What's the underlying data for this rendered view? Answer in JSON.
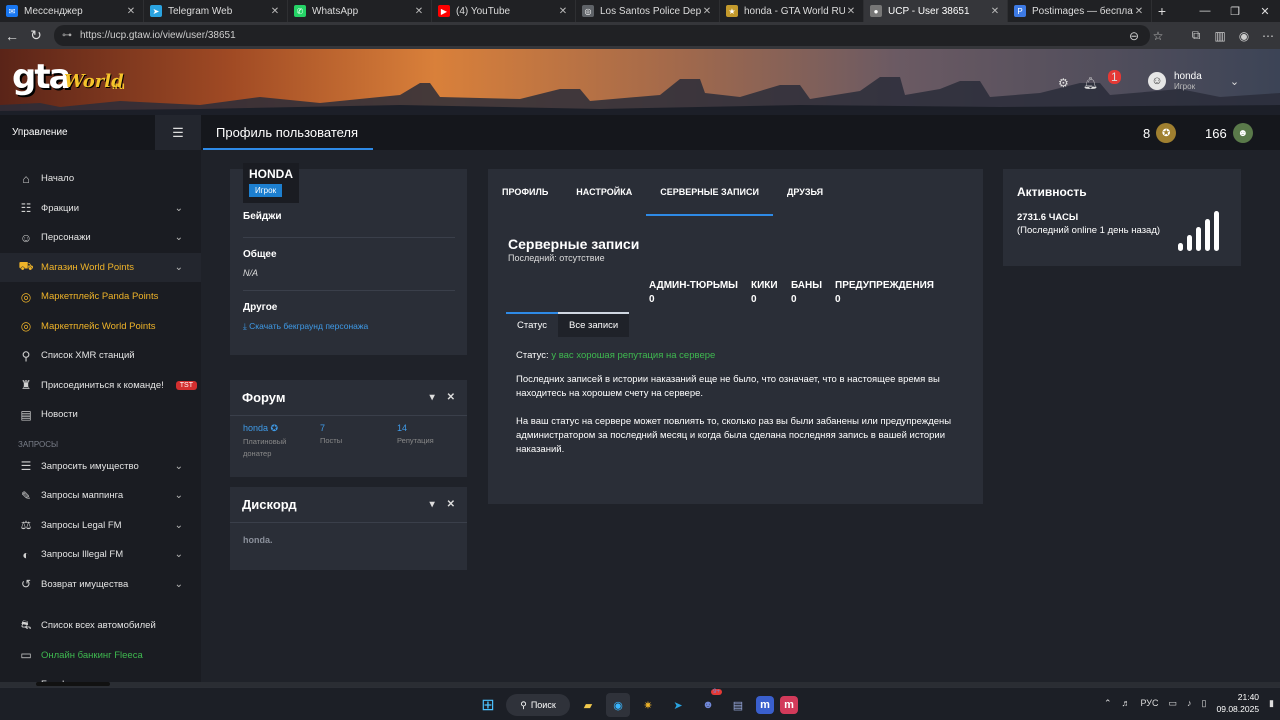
{
  "browser": {
    "tabs": [
      {
        "title": "Мессенджер",
        "color": "#1877f2",
        "glyph": "✉"
      },
      {
        "title": "Telegram Web",
        "color": "#2aa3e0",
        "glyph": "➤"
      },
      {
        "title": "WhatsApp",
        "color": "#25d366",
        "glyph": "✆"
      },
      {
        "title": "(4) YouTube",
        "color": "#ff0000",
        "glyph": "▶"
      },
      {
        "title": "Los Santos Police Departme",
        "color": "#5f6368",
        "glyph": "◎"
      },
      {
        "title": "honda - GTA World RU",
        "color": "#c49a2c",
        "glyph": "★"
      },
      {
        "title": "UCP - User 38651",
        "color": "#777777",
        "glyph": "●"
      },
      {
        "title": "Postimages — бесплатный",
        "color": "#3d7ae4",
        "glyph": "P"
      }
    ],
    "active_tab": 6,
    "url": "https://ucp.gtaw.io/view/user/38651"
  },
  "header": {
    "logo_main": "gta",
    "logo_world": "World",
    "logo_ru": ".ru",
    "notif_count": "1",
    "username": "honda",
    "role": "Игрок"
  },
  "sidebar": {
    "title": "Управление",
    "items": [
      {
        "label": "Начало",
        "icon": "home-icon",
        "glyph": "⌂"
      },
      {
        "label": "Фракции",
        "icon": "users-icon",
        "glyph": "☷",
        "chevron": true
      },
      {
        "label": "Персонажи",
        "icon": "user-icon",
        "glyph": "☺",
        "chevron": true
      },
      {
        "label": "Магазин World Points",
        "icon": "cart-icon",
        "glyph": "⛟",
        "chevron": true,
        "active": true
      },
      {
        "label": "Маркетплейс Panda Points",
        "icon": "coins-icon",
        "glyph": "◎",
        "gold": true
      },
      {
        "label": "Маркетплейс World Points",
        "icon": "coins-icon",
        "glyph": "◎",
        "gold": true
      },
      {
        "label": "Список XMR станций",
        "icon": "antenna-icon",
        "glyph": "⚲"
      },
      {
        "label": "Присоединиться к команде!",
        "icon": "user-tie-icon",
        "glyph": "♜",
        "tag": "TST"
      },
      {
        "label": "Новости",
        "icon": "news-icon",
        "glyph": "▤"
      }
    ],
    "section_requests": "ЗАПРОСЫ",
    "requests": [
      {
        "label": "Запросить имущество",
        "icon": "list-icon",
        "glyph": "☰"
      },
      {
        "label": "Запросы маппинга",
        "icon": "brush-icon",
        "glyph": "✎"
      },
      {
        "label": "Запросы Legal FM",
        "icon": "scale-icon",
        "glyph": "⚖"
      },
      {
        "label": "Запросы Illegal FM",
        "icon": "mask-icon",
        "glyph": "◐"
      },
      {
        "label": "Возврат имущества",
        "icon": "undo-icon",
        "glyph": "↺"
      }
    ],
    "extra": [
      {
        "label": "Список всех автомобилей",
        "icon": "car-icon",
        "glyph": "⛐"
      },
      {
        "label": "Онлайн банкинг Fleeca",
        "icon": "bank-icon",
        "glyph": "▭",
        "green": true
      },
      {
        "label": "Facebrowser",
        "icon": "user-icon",
        "glyph": "☺"
      }
    ]
  },
  "topbar": {
    "page_title": "Профиль пользователя",
    "stat1": "8",
    "stat2": "166"
  },
  "profile": {
    "name": "HONDA",
    "badge": "Игрок",
    "badges_label": "Бейджи",
    "general_label": "Общее",
    "general_value": "N/A",
    "other_label": "Другое",
    "download_link": "Скачать бекграунд персонажа"
  },
  "forum": {
    "title": "Форум",
    "user": "honda",
    "user_role": "Платиновый донатер",
    "posts": "7",
    "posts_label": "Посты",
    "rep": "14",
    "rep_label": "Репутация"
  },
  "discord": {
    "title": "Дискорд",
    "name": "honda."
  },
  "records": {
    "tabs": [
      "ПРОФИЛЬ",
      "НАСТРОЙКА",
      "СЕРВЕРНЫЕ ЗАПИСИ",
      "ДРУЗЬЯ"
    ],
    "active_tab": 2,
    "title": "Серверные записи",
    "last": "Последний: отсутствие",
    "counters": [
      {
        "label": "АДМИН-ТЮРЬМЫ",
        "value": "0"
      },
      {
        "label": "КИКИ",
        "value": "0"
      },
      {
        "label": "БАНЫ",
        "value": "0"
      },
      {
        "label": "ПРЕДУПРЕЖДЕНИЯ",
        "value": "0"
      }
    ],
    "subtabs": [
      "Статус",
      "Все записи"
    ],
    "status_label": "Статус:",
    "status_value": "у вас хорошая репутация на сервере",
    "para1": "Последних записей в истории наказаний еще не было, что означает, что в настоящее время вы находитесь на хорошем счету на сервере.",
    "para2": "На ваш статус на сервере может повлиять то, сколько раз вы были забанены или предупреждены администратором за последний месяц и когда была сделана последняя запись в вашей истории наказаний."
  },
  "activity": {
    "title": "Активность",
    "hours": "2731.6 ЧАСЫ",
    "last_online": "(Последний online 1 день назад)"
  },
  "taskbar": {
    "search": "Поиск",
    "lang": "РУС",
    "time": "21:40",
    "date": "09.08.2025",
    "discord_badge": "9+"
  },
  "colors": {
    "accent": "#2e8ae6",
    "gold": "#f0b429",
    "green": "#3fb950"
  }
}
